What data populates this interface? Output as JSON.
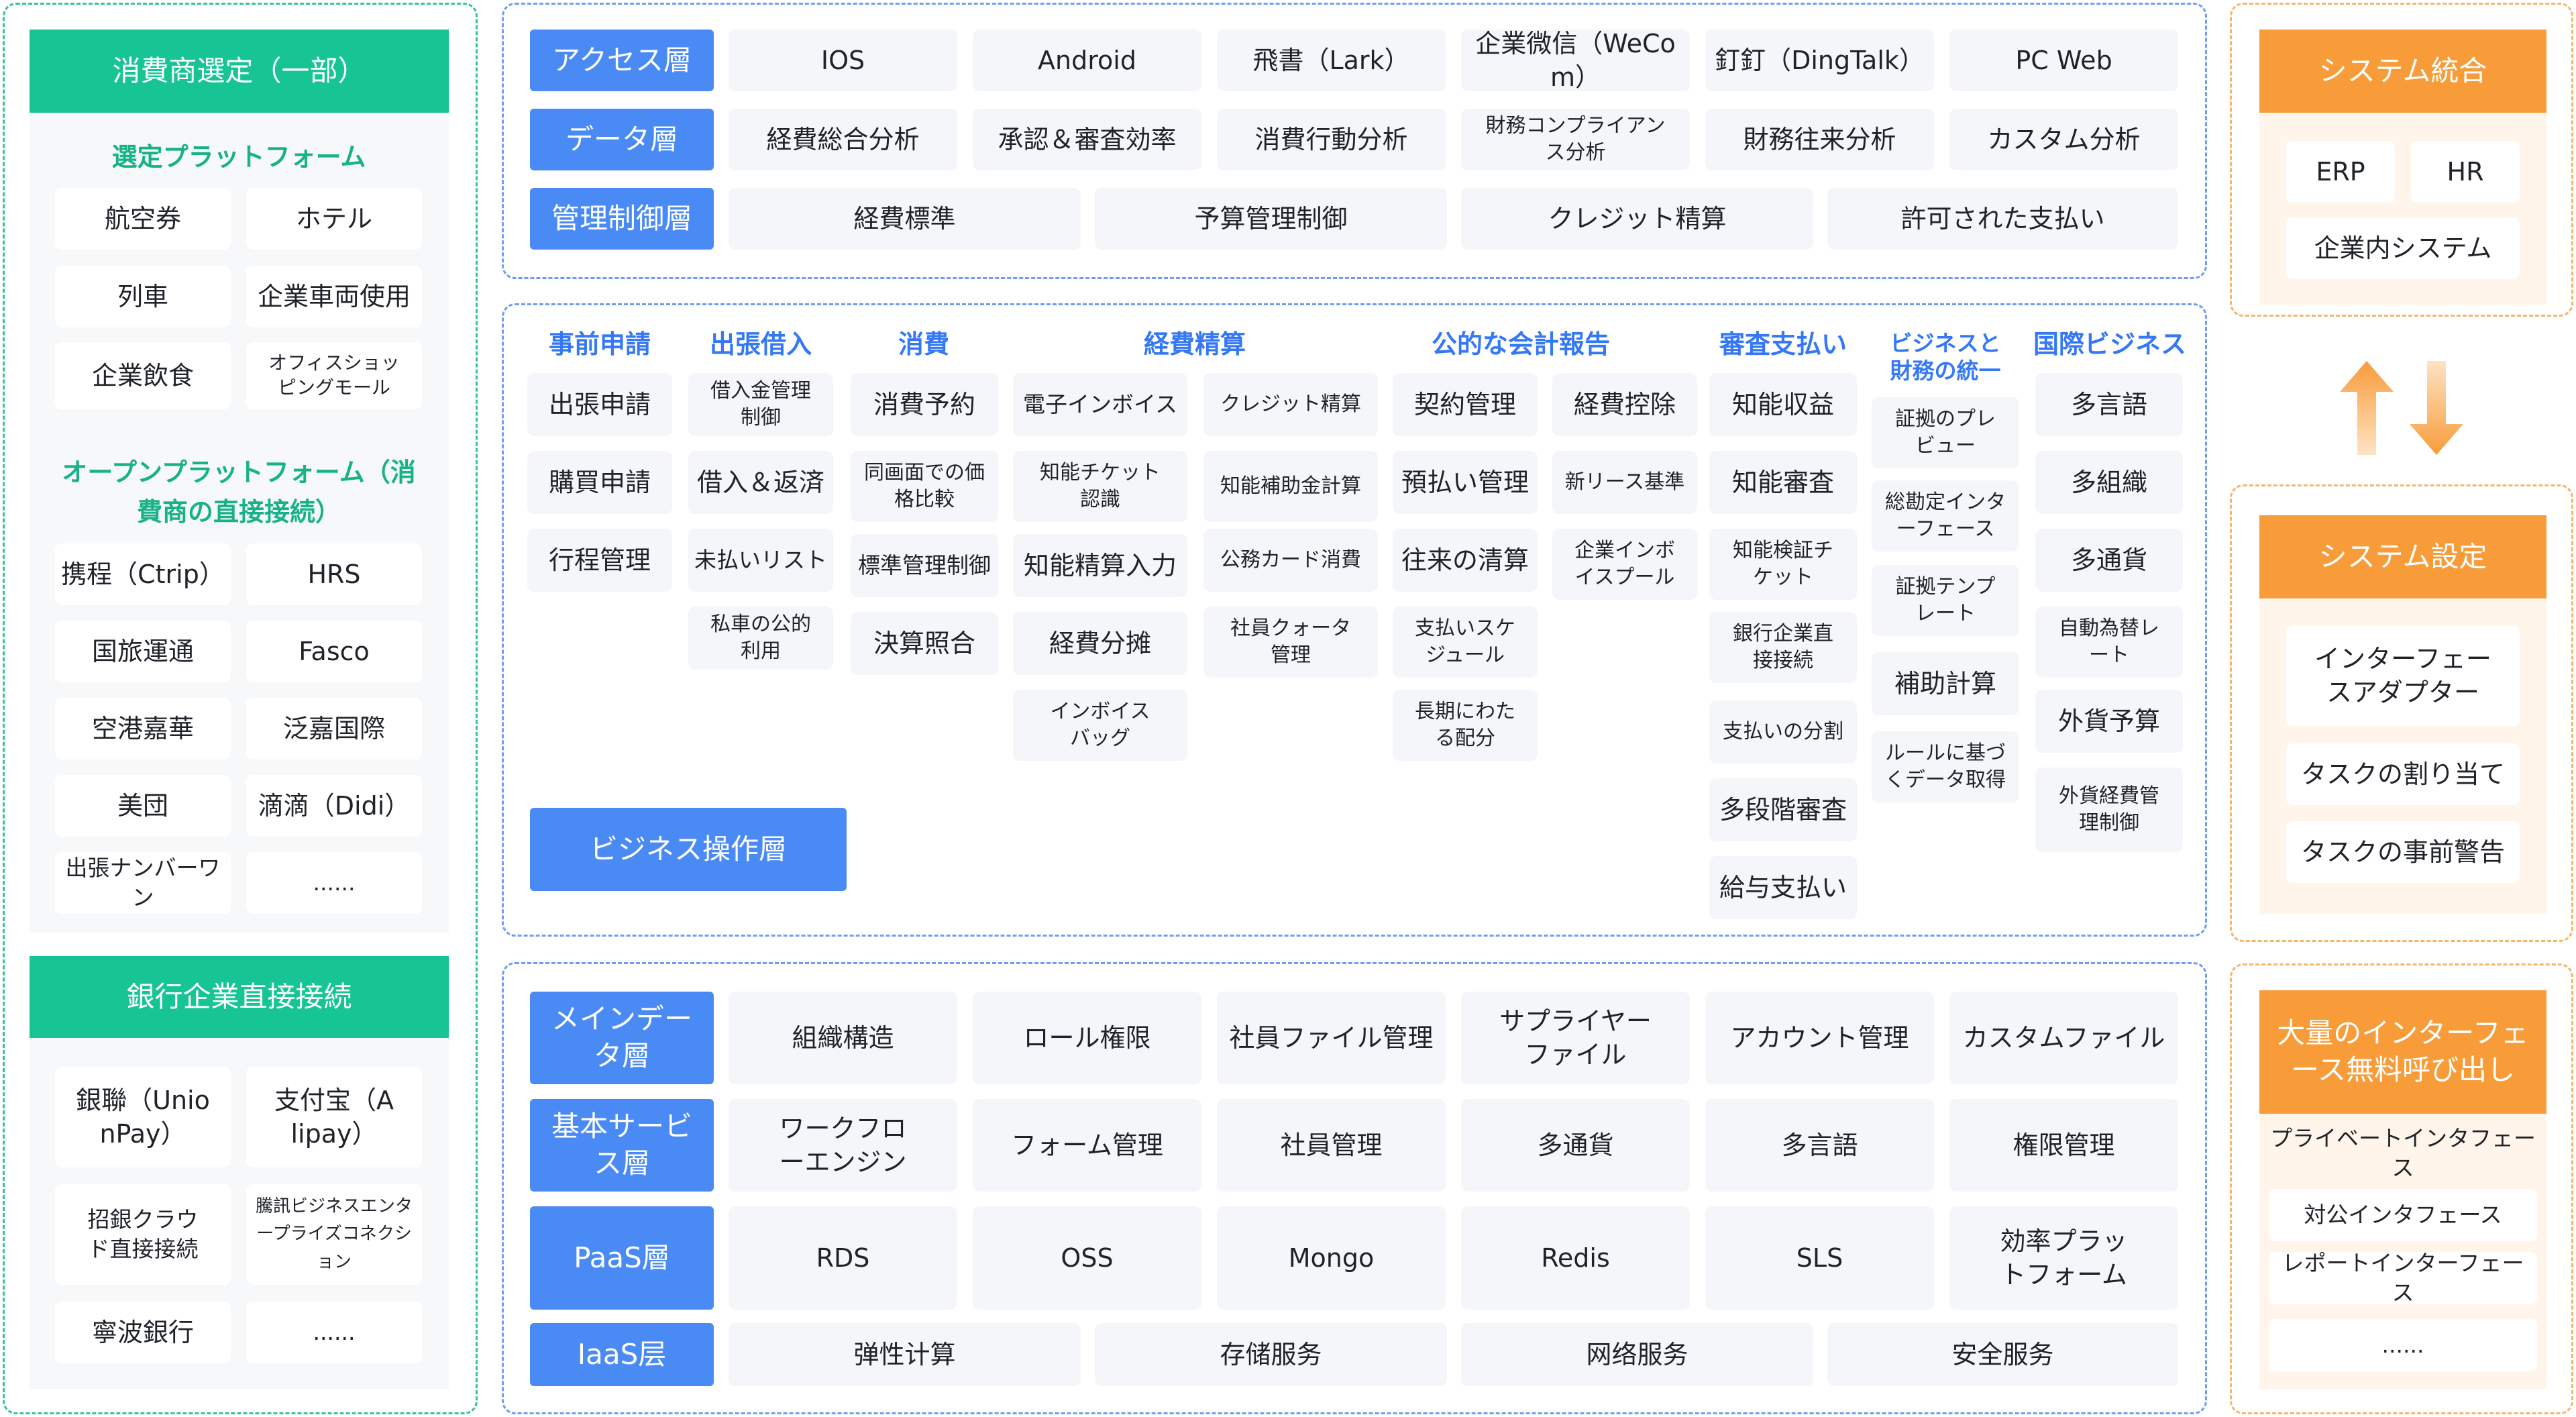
{
  "colors": {
    "green": "#17c493",
    "blue": "#4a8af4",
    "orange": "#f89c3a",
    "link_blue": "#3578f6"
  },
  "left": {
    "consumer_title": "消費商選定（一部）",
    "selected_platform_title": "選定プラットフォーム",
    "selected_items": [
      "航空券",
      "ホテル",
      "列車",
      "企業車両使用",
      "企業飲食",
      "オフィスショッピングモール"
    ],
    "open_platform_title": "オープンプラットフォーム（消費商の直接接続）",
    "open_items": [
      "携程（Ctrip）",
      "HRS",
      "国旅運通",
      "Fasco",
      "空港嘉華",
      "泛嘉国際",
      "美団",
      "滴滴（Didi）",
      "出張ナンバーワン",
      "......"
    ],
    "bank_title": "銀行企業直接接続",
    "bank_items": [
      "銀聯（UnionPay）",
      "支付宝（Alipay）",
      "招銀クラウド直接接続",
      "騰訊ビジネスエンタープライズコネクション",
      "寧波銀行",
      "......"
    ]
  },
  "top": {
    "access_label": "アクセス層",
    "access_items": [
      "IOS",
      "Android",
      "飛書（Lark）",
      "企業微信（WeCom）",
      "釘釘（DingTalk）",
      "PC Web"
    ],
    "data_label": "データ層",
    "data_items": [
      "経費総合分析",
      "承認＆審査効率",
      "消費行動分析",
      "財務コンプライアンス分析",
      "財務往来分析",
      "カスタム分析"
    ],
    "mgmt_label": "管理制御層",
    "mgmt_items": [
      "経費標準",
      "予算管理制御",
      "クレジット精算",
      "許可された支払い"
    ]
  },
  "business": {
    "label": "ビジネス操作層",
    "columns": [
      {
        "title": "事前申請",
        "items": [
          "出張申請",
          "購買申請",
          "行程管理"
        ]
      },
      {
        "title": "出張借入",
        "items": [
          "借入金管理制御",
          "借入＆返済",
          "未払いリスト",
          "私車の公的利用"
        ]
      },
      {
        "title": "消費",
        "items": [
          "消費予約",
          "同画面での価格比較",
          "標準管理制御",
          "決算照合"
        ]
      },
      {
        "title": "経費精算",
        "items": [
          "電子インボイス",
          "クレジット精算",
          "知能チケット認識",
          "知能補助金計算",
          "知能精算入力",
          "公務カード消費",
          "経費分摊",
          "社員クォータ管理",
          "インボイスバッグ"
        ]
      },
      {
        "title": "公的な会計報告",
        "items": [
          "契約管理",
          "経費控除",
          "預払い管理",
          "新リース基準",
          "往来の清算",
          "企業インボイスプール",
          "支払いスケジュール",
          "長期にわたる配分"
        ]
      },
      {
        "title": "審査支払い",
        "items": [
          "知能収益",
          "知能審査",
          "知能検証チケット",
          "銀行企業直接接続",
          "支払いの分割",
          "多段階審査",
          "給与支払い"
        ]
      },
      {
        "title": "ビジネスと財務の統一",
        "items": [
          "証拠のプレビュー",
          "総勘定インターフェース",
          "証拠テンプレート",
          "補助計算",
          "ルールに基づくデータ取得"
        ]
      },
      {
        "title": "国際ビジネス",
        "items": [
          "多言語",
          "多組織",
          "多通貨",
          "自動為替レート",
          "外貨予算",
          "外貨経費管理制御"
        ]
      }
    ]
  },
  "bottom": {
    "master_label": "メインデータ層",
    "master_items": [
      "組織構造",
      "ロール権限",
      "社員ファイル管理",
      "サプライヤーファイル",
      "アカウント管理",
      "カスタムファイル"
    ],
    "basic_label": "基本サービス層",
    "basic_items": [
      "ワークフローエンジン",
      "フォーム管理",
      "社員管理",
      "多通貨",
      "多言語",
      "権限管理"
    ],
    "paas_label": "PaaS層",
    "paas_items": [
      "RDS",
      "OSS",
      "Mongo",
      "Redis",
      "SLS",
      "効率プラットフォーム"
    ],
    "iaas_label": "IaaS层",
    "iaas_items": [
      "弹性计算",
      "存储服务",
      "网络服务",
      "安全服务"
    ]
  },
  "right": {
    "integration_title": "システム統合",
    "integration_items": [
      "ERP",
      "HR",
      "企業内システム"
    ],
    "settings_title": "システム設定",
    "settings_items": [
      "インターフェースアダプター",
      "タスクの割り当て",
      "タスクの事前警告"
    ],
    "api_title": "大量のインターフェース無料呼び出し",
    "api_items": [
      "プライベートインタフェース",
      "対公インタフェース",
      "レポートインターフェース",
      "......"
    ]
  }
}
